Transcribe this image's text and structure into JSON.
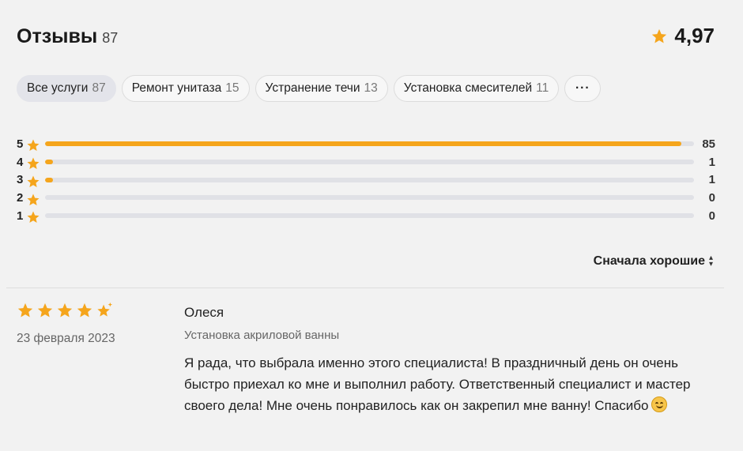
{
  "header": {
    "title": "Отзывы",
    "count": "87",
    "rating": "4,97"
  },
  "filters": [
    {
      "label": "Все услуги",
      "count": "87",
      "active": true
    },
    {
      "label": "Ремонт унитаза",
      "count": "15",
      "active": false
    },
    {
      "label": "Устранение течи",
      "count": "13",
      "active": false
    },
    {
      "label": "Установка смесителей",
      "count": "11",
      "active": false
    }
  ],
  "more_label": "···",
  "distribution": [
    {
      "stars": "5",
      "count": "85",
      "fraction": 0.98
    },
    {
      "stars": "4",
      "count": "1",
      "fraction": 0.012
    },
    {
      "stars": "3",
      "count": "1",
      "fraction": 0.012
    },
    {
      "stars": "2",
      "count": "0",
      "fraction": 0
    },
    {
      "stars": "1",
      "count": "0",
      "fraction": 0
    }
  ],
  "sort": {
    "label": "Сначала хорошие"
  },
  "review": {
    "rating": 5,
    "date": "23 февраля 2023",
    "author": "Олеся",
    "service": "Установка акриловой ванны",
    "text": "Я рада, что выбрала именно этого специалиста! В праздничный день он очень быстро приехал ко мне и выполнил работу. Ответственный специалист и мастер своего дела! Мне очень понравилось как он закрепил мне ванну! Спасибо"
  },
  "colors": {
    "accent": "#f5a51c",
    "track": "#e0e1e6",
    "background": "#f2f2f2"
  },
  "icons": {
    "star": "star-icon",
    "emoji": "smiling-face-emoji",
    "sort": "sort-arrows-icon"
  }
}
